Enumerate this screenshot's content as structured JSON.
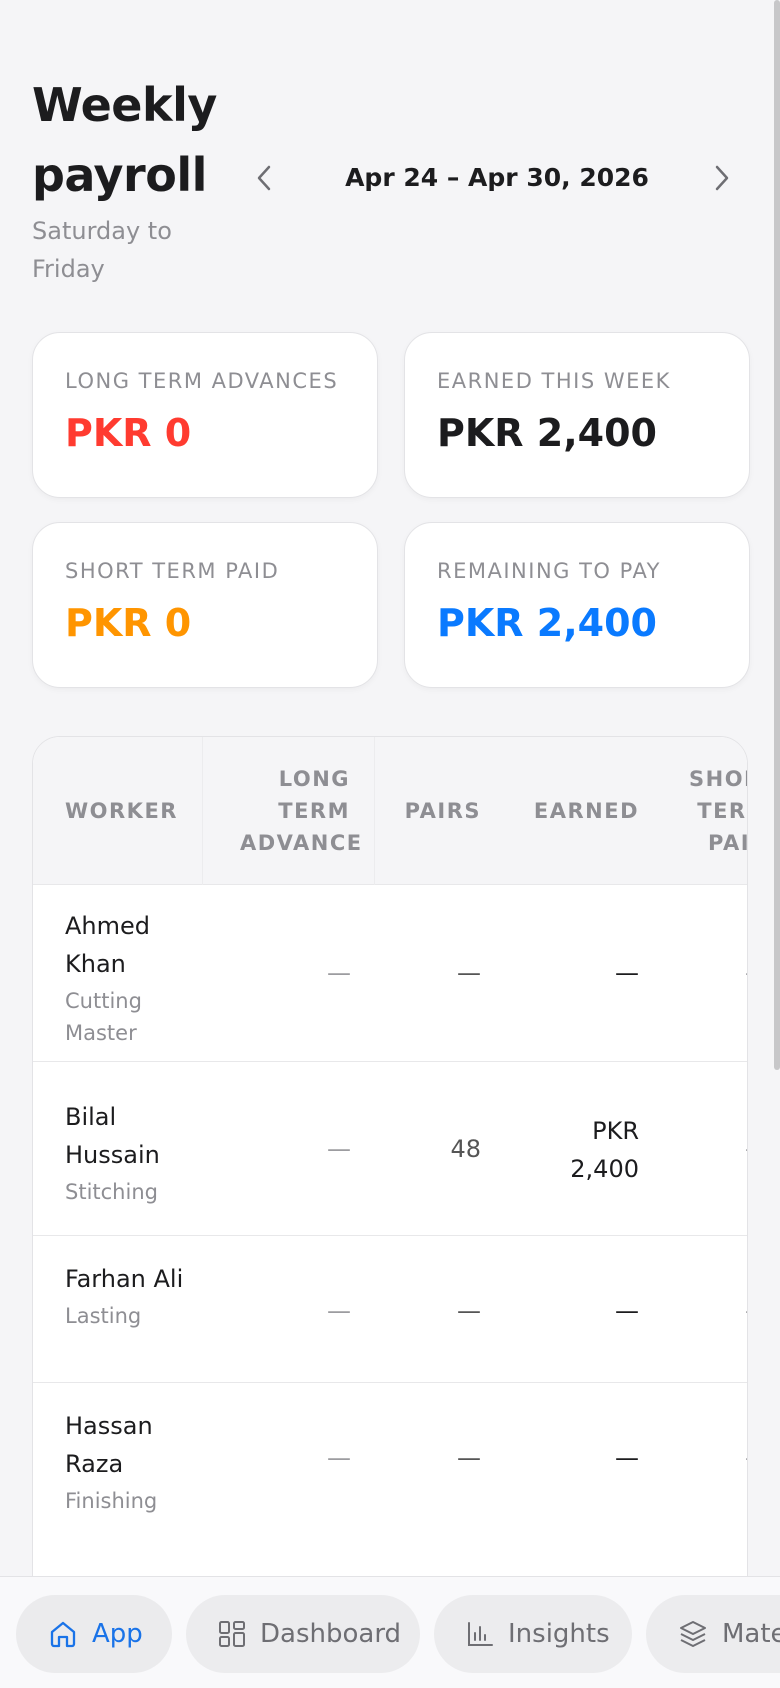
{
  "header": {
    "title": "Weekly payroll",
    "subtitle": "Saturday to Friday",
    "week_range": "Apr 24 – Apr 30, 2026"
  },
  "stats": [
    {
      "label": "LONG TERM ADVANCES",
      "value": "PKR 0",
      "color": "#ff3b30"
    },
    {
      "label": "EARNED THIS WEEK",
      "value": "PKR 2,400",
      "color": "#1c1c1e"
    },
    {
      "label": "SHORT TERM PAID",
      "value": "PKR 0",
      "color": "#ff9500"
    },
    {
      "label": "REMAINING TO PAY",
      "value": "PKR 2,400",
      "color": "#0a7aff"
    }
  ],
  "table": {
    "columns": {
      "worker": "WORKER",
      "long_term_advance": "LONG TERM ADVANCE",
      "pairs": "PAIRS",
      "earned": "EARNED",
      "short_term_paid": "SHORT TERM PAID"
    },
    "rows": [
      {
        "name": "Ahmed Khan",
        "role": "Cutting Master",
        "long_term_advance": "—",
        "pairs": "—",
        "earned": "—",
        "short_term_paid": "—"
      },
      {
        "name": "Bilal Hussain",
        "role": "Stitching",
        "long_term_advance": "—",
        "pairs": "48",
        "earned": "PKR 2,400",
        "short_term_paid": "—"
      },
      {
        "name": "Farhan Ali",
        "role": "Lasting",
        "long_term_advance": "—",
        "pairs": "—",
        "earned": "—",
        "short_term_paid": "—"
      },
      {
        "name": "Hassan Raza",
        "role": "Finishing",
        "long_term_advance": "—",
        "pairs": "—",
        "earned": "—",
        "short_term_paid": "—"
      }
    ]
  },
  "bottom_nav": {
    "items": [
      {
        "label": "App",
        "icon": "home-icon",
        "active": true
      },
      {
        "label": "Dashboard",
        "icon": "dashboard-icon",
        "active": false
      },
      {
        "label": "Insights",
        "icon": "bar-chart-icon",
        "active": false
      },
      {
        "label": "Materials",
        "icon": "layers-icon",
        "active": false
      }
    ]
  },
  "colors": {
    "accent": "#1a73e8",
    "danger": "#ff3b30",
    "warning": "#ff9500",
    "info": "#0a7aff"
  }
}
